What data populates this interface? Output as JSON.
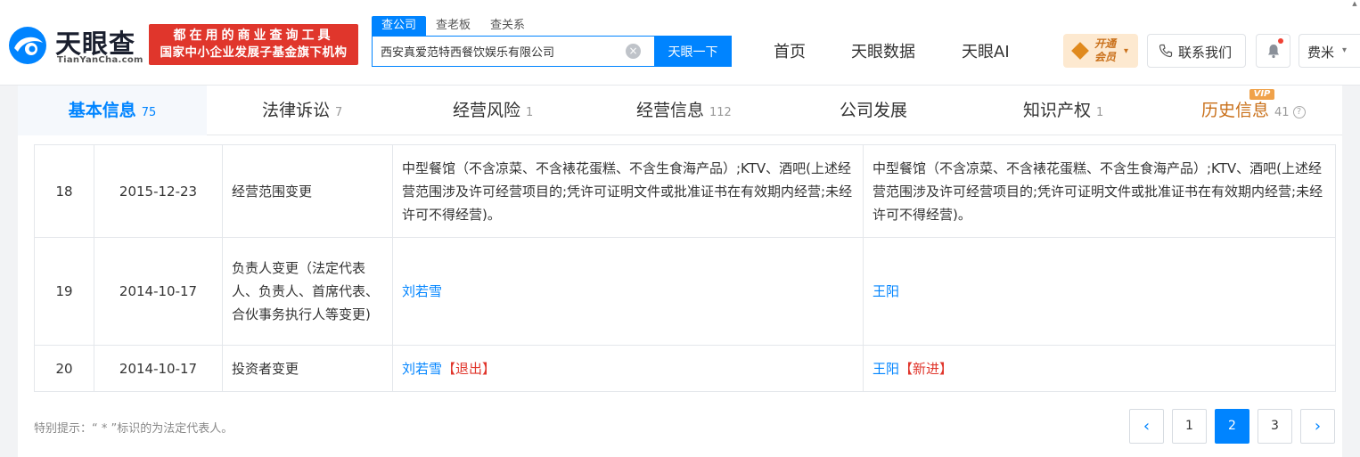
{
  "brand": {
    "logo_text": "天眼查",
    "logo_sub": "TianYanCha.com",
    "slogan_line1": "都在用的商业查询工具",
    "slogan_line2": "国家中小企业发展子基金旗下机构"
  },
  "search": {
    "tabs": [
      "查公司",
      "查老板",
      "查关系"
    ],
    "value": "西安真爱范特西餐饮娱乐有限公司",
    "button": "天眼一下"
  },
  "nav": {
    "home": "首页",
    "data": "天眼数据",
    "ai": "天眼AI",
    "vip_line1": "开通",
    "vip_line2": "会员",
    "contact": "联系我们",
    "user": "费米"
  },
  "tabs": [
    {
      "label": "基本信息",
      "count": "75"
    },
    {
      "label": "法律诉讼",
      "count": "7"
    },
    {
      "label": "经营风险",
      "count": "1"
    },
    {
      "label": "经营信息",
      "count": "112"
    },
    {
      "label": "公司发展",
      "count": ""
    },
    {
      "label": "知识产权",
      "count": "1"
    },
    {
      "label": "历史信息",
      "count": "41"
    }
  ],
  "vip_badge": "VIP",
  "rows": [
    {
      "index": "18",
      "date": "2015-12-23",
      "item": "经营范围变更",
      "before": "中型餐馆（不含凉菜、不含裱花蛋糕、不含生食海产品）;KTV、酒吧(上述经营范围涉及许可经营项目的;凭许可证明文件或批准证书在有效期内经营;未经许可不得经营)。",
      "after": "中型餐馆（不含凉菜、不含裱花蛋糕、不含生食海产品）;KTV、酒吧(上述经营范围涉及许可经营项目的;凭许可证明文件或批准证书在有效期内经营;未经许可不得经营)。"
    },
    {
      "index": "19",
      "date": "2014-10-17",
      "item": "负责人变更（法定代表人、负责人、首席代表、合伙事务执行人等变更)",
      "before_name": "刘若雪",
      "after_name": "王阳"
    },
    {
      "index": "20",
      "date": "2014-10-17",
      "item": "投资者变更",
      "before_name": "刘若雪",
      "before_tag": "【退出】",
      "after_name": "王阳",
      "after_tag": "【新进】"
    }
  ],
  "footnote": "特别提示：“ * ”标识的为法定代表人。",
  "pagination": {
    "pages": [
      "1",
      "2",
      "3"
    ],
    "current": "2",
    "prev": "‹",
    "next": "›"
  }
}
